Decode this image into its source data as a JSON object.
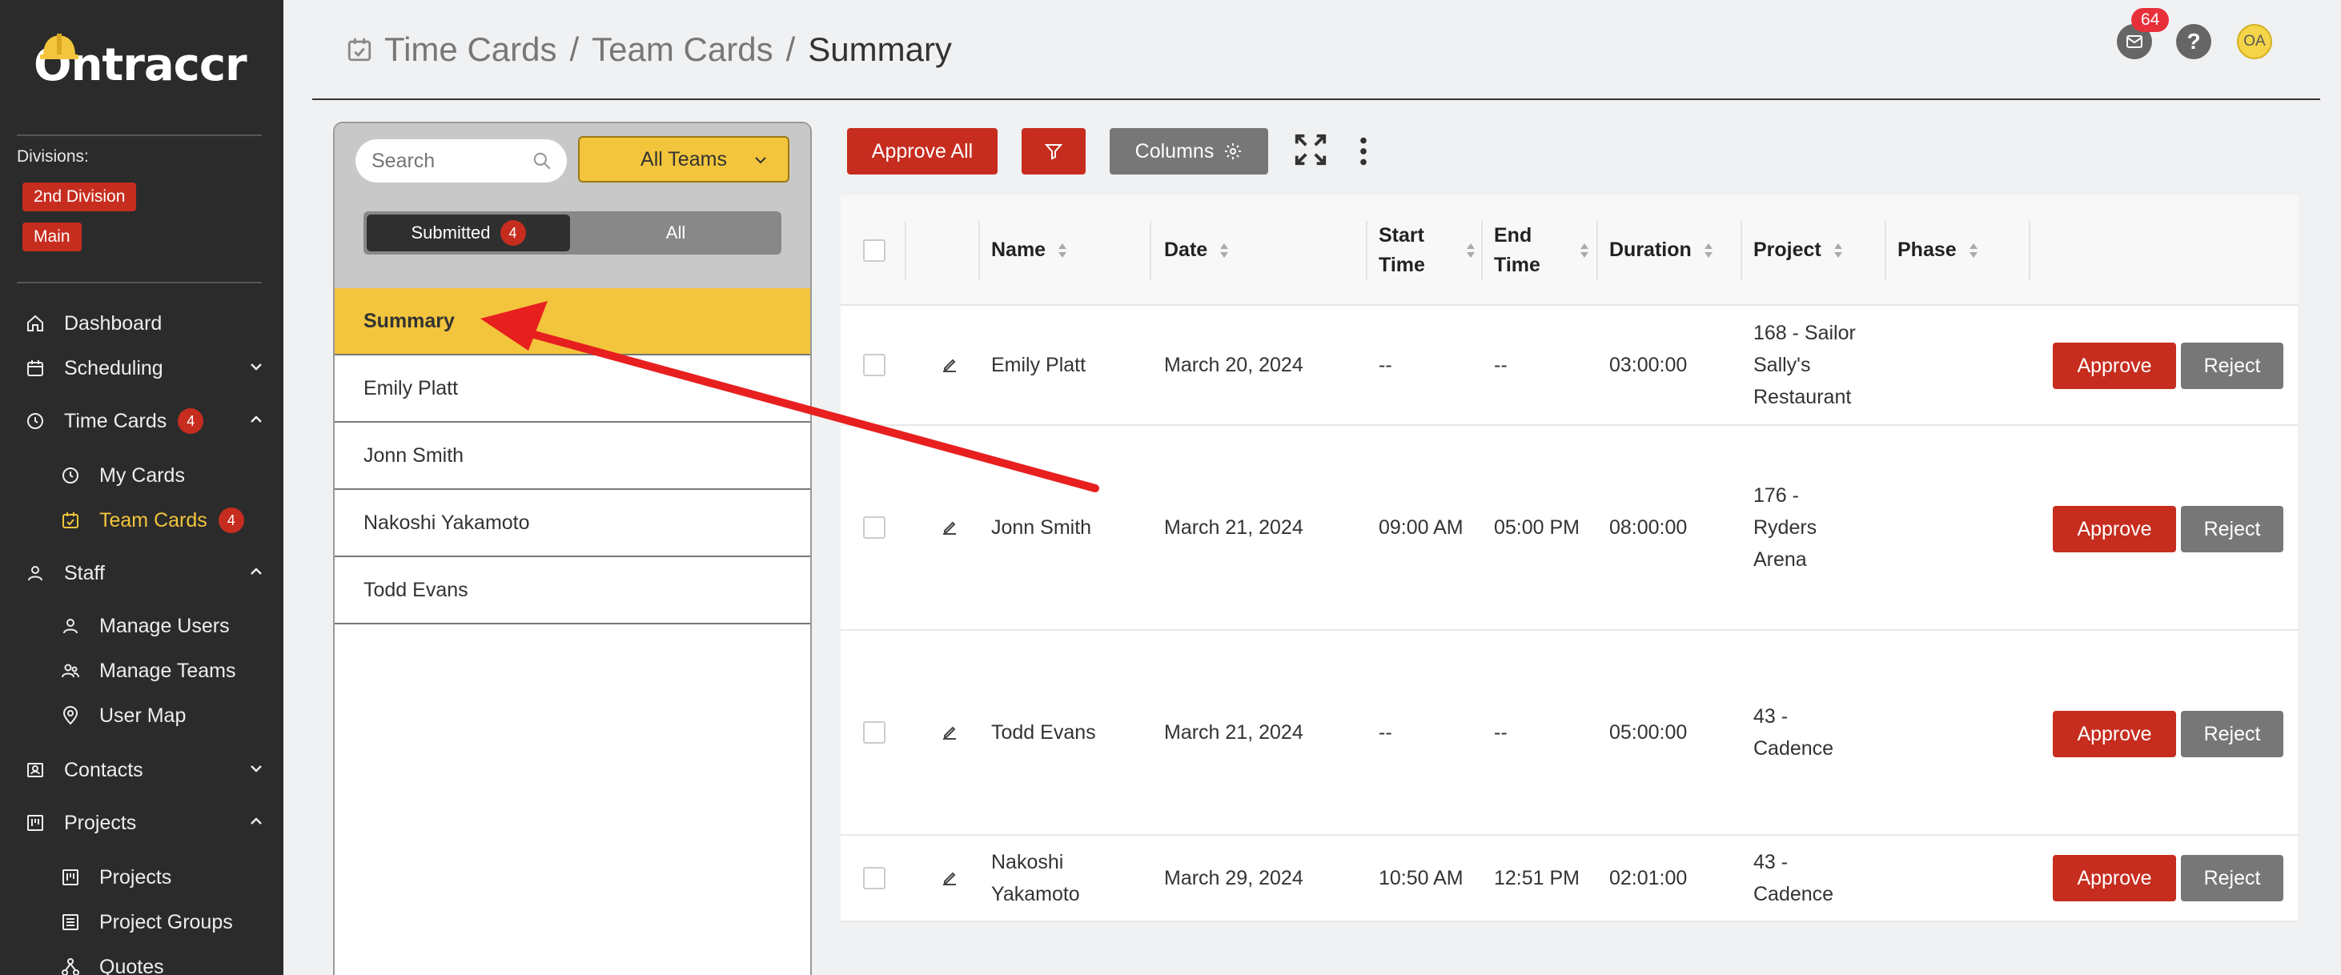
{
  "app": {
    "logo_text": "Ontraccr"
  },
  "sidebar": {
    "divisions_label": "Divisions:",
    "divisions": [
      "2nd Division",
      "Main"
    ],
    "items": {
      "dashboard": "Dashboard",
      "scheduling": "Scheduling",
      "time_cards": "Time Cards",
      "time_cards_count": "4",
      "my_cards": "My Cards",
      "team_cards": "Team Cards",
      "team_cards_count": "4",
      "staff": "Staff",
      "manage_users": "Manage Users",
      "manage_teams": "Manage Teams",
      "user_map": "User Map",
      "contacts": "Contacts",
      "projects": "Projects",
      "projects_sub": "Projects",
      "project_groups": "Project Groups",
      "quotes": "Quotes"
    }
  },
  "header": {
    "breadcrumb": [
      "Time Cards",
      "Team Cards",
      "Summary"
    ],
    "separator": "/",
    "mail_count": "64",
    "avatar_initials": "OA"
  },
  "panel": {
    "search_placeholder": "Search",
    "team_select": "All Teams",
    "toggle_submitted": "Submitted",
    "toggle_submitted_count": "4",
    "toggle_all": "All",
    "list": [
      "Summary",
      "Emily Platt",
      "Jonn Smith",
      "Nakoshi Yakamoto",
      "Todd Evans"
    ]
  },
  "toolbar": {
    "approve_all": "Approve All",
    "columns": "Columns"
  },
  "table": {
    "headers": {
      "name": "Name",
      "date": "Date",
      "start_time_1": "Start",
      "start_time_2": "Time",
      "end_time_1": "End",
      "end_time_2": "Time",
      "duration": "Duration",
      "project": "Project",
      "phase": "Phase"
    },
    "approve_label": "Approve",
    "reject_label": "Reject",
    "rows": [
      {
        "name": "Emily Platt",
        "date": "March 20, 2024",
        "start": "--",
        "end": "--",
        "duration": "03:00:00",
        "project": "168 - Sailor Sally's Restaurant",
        "phase": ""
      },
      {
        "name": "Jonn Smith",
        "date": "March 21, 2024",
        "start": "09:00 AM",
        "end": "05:00 PM",
        "duration": "08:00:00",
        "project": "176 - Ryders Arena",
        "phase": ""
      },
      {
        "name": "Todd Evans",
        "date": "March 21, 2024",
        "start": "--",
        "end": "--",
        "duration": "05:00:00",
        "project": "43 - Cadence",
        "phase": ""
      },
      {
        "name": "Nakoshi Yakamoto",
        "date": "March 29, 2024",
        "start": "10:50 AM",
        "end": "12:51 PM",
        "duration": "02:01:00",
        "project": "43 - Cadence",
        "phase": ""
      }
    ]
  },
  "colors": {
    "sidebar_bg": "#2b2b2b",
    "accent_yellow": "#f2c53d",
    "primary_red": "#c62d1f",
    "gray_button": "#777777",
    "annotation_arrow": "#e81f1f"
  }
}
